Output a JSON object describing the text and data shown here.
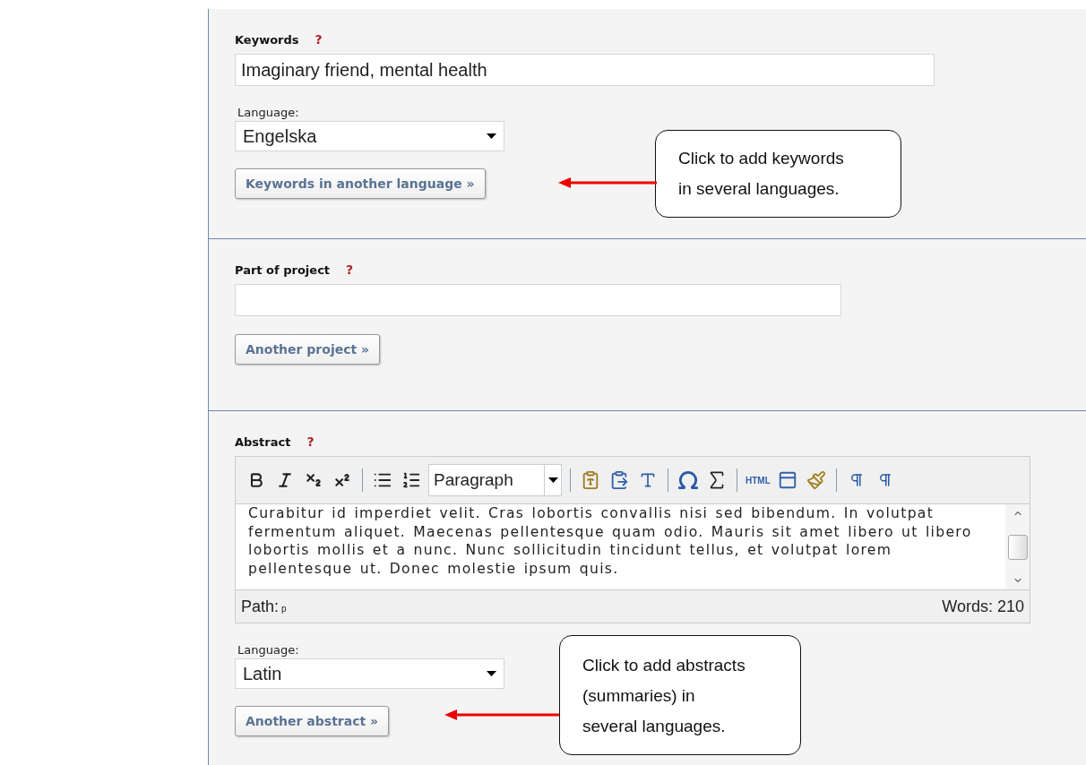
{
  "sections": [
    {
      "kind": "keywords",
      "label": "Keywords",
      "help": "?",
      "value": "Imaginary friend, mental health",
      "language_label": "Language:",
      "language": "Engelska",
      "button": "Keywords in another language »",
      "callout": {
        "lines": [
          "Click to add keywords",
          "in several languages."
        ]
      }
    },
    {
      "kind": "project",
      "label": "Part of project",
      "help": "?",
      "button": "Another project »"
    },
    {
      "kind": "abstract",
      "label": "Abstract",
      "help": "?",
      "editor": {
        "format": "Paragraph",
        "html_label": "HTML",
        "content": "Curabitur id imperdiet velit. Cras lobortis convallis nisi sed bibendum. In volutpat fermentum aliquet. Maecenas pellentesque quam odio. Mauris sit amet libero ut libero lobortis mollis et a nunc. Nunc sollicitudin tincidunt tellus, et volutpat lorem pellentesque ut. Donec molestie ipsum quis.",
        "path_label": "Path:",
        "path": "p",
        "words": "Words: 210"
      },
      "language_label": "Language:",
      "language": "Latin",
      "button": "Another abstract »",
      "callout": {
        "lines": [
          "Click to add abstracts",
          "(summaries) in",
          "several languages."
        ]
      }
    }
  ]
}
